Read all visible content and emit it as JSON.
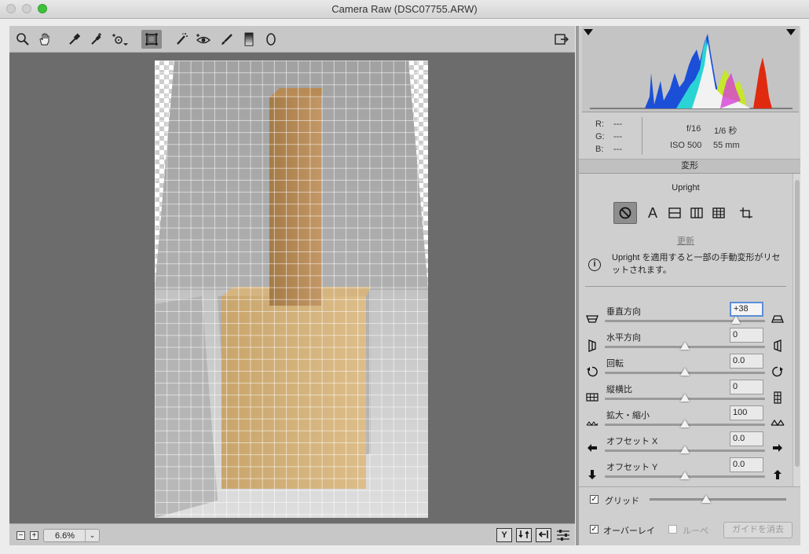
{
  "window": {
    "title": "Camera Raw (DSC07755.ARW)"
  },
  "toolbar": {
    "tools": [
      {
        "name": "zoom-tool-icon"
      },
      {
        "name": "hand-tool-icon"
      },
      {
        "name": "white-balance-tool-icon"
      },
      {
        "name": "color-sampler-tool-icon"
      },
      {
        "name": "targeted-adjustment-tool-icon"
      },
      {
        "name": "transform-tool-icon"
      },
      {
        "name": "spot-removal-tool-icon"
      },
      {
        "name": "red-eye-removal-tool-icon"
      },
      {
        "name": "adjustment-brush-icon"
      },
      {
        "name": "graduated-filter-icon"
      },
      {
        "name": "radial-filter-icon"
      }
    ],
    "active_tool": "transform-tool-icon",
    "right_icon": "open-preferences-icon"
  },
  "status": {
    "zoom_minus": "−",
    "zoom_plus": "+",
    "zoom_value": "6.6%",
    "zoom_caret": "⌄",
    "icons": [
      "toggle-before-after-icon",
      "swap-before-after-icon",
      "copy-settings-icon",
      "settings-icon"
    ],
    "y_label": "Y"
  },
  "readout": {
    "r_label": "R:",
    "r_value": "---",
    "g_label": "G:",
    "g_value": "---",
    "b_label": "B:",
    "b_value": "---",
    "aperture": "f/16",
    "shutter": "1/6 秒",
    "iso": "ISO 500",
    "focal": "55 mm"
  },
  "panel": {
    "section_tab": "変形",
    "upright_title": "Upright",
    "upright_buttons": [
      "upright-off",
      "upright-auto",
      "upright-level",
      "upright-vertical",
      "upright-full",
      "upright-guided"
    ],
    "upright_auto_label": "A",
    "update_label": "更新",
    "info_icon": "i",
    "info_text": "Upright を適用すると一部の手動変形がリセットされます。",
    "sliders": [
      {
        "label": "垂直方向",
        "value": "+38",
        "position": 0.82,
        "left_icon": "vertical-perspective-left-icon",
        "right_icon": "vertical-perspective-right-icon"
      },
      {
        "label": "水平方向",
        "value": "0",
        "position": 0.5,
        "left_icon": "horizontal-perspective-left-icon",
        "right_icon": "horizontal-perspective-right-icon"
      },
      {
        "label": "回転",
        "value": "0.0",
        "position": 0.5,
        "left_icon": "rotate-left-icon",
        "right_icon": "rotate-right-icon"
      },
      {
        "label": "縦横比",
        "value": "0",
        "position": 0.5,
        "left_icon": "aspect-wide-icon",
        "right_icon": "aspect-tall-icon"
      },
      {
        "label": "拡大・縮小",
        "value": "100",
        "position": 0.5,
        "left_icon": "scale-down-icon",
        "right_icon": "scale-up-icon"
      },
      {
        "label": "オフセット X",
        "value": "0.0",
        "position": 0.5,
        "left_icon": "offset-left-arrow-icon",
        "right_icon": "offset-right-arrow-icon"
      },
      {
        "label": "オフセット Y",
        "value": "0.0",
        "position": 0.5,
        "left_icon": "offset-down-arrow-icon",
        "right_icon": "offset-up-arrow-icon"
      }
    ],
    "grid_label": "グリッド",
    "grid_checked": "✓",
    "grid_level": 0.38,
    "overlay_label": "オーバーレイ",
    "overlay_checked": "✓",
    "loupe_label": "ルーペ",
    "clear_guides_label": "ガイドを消去"
  }
}
